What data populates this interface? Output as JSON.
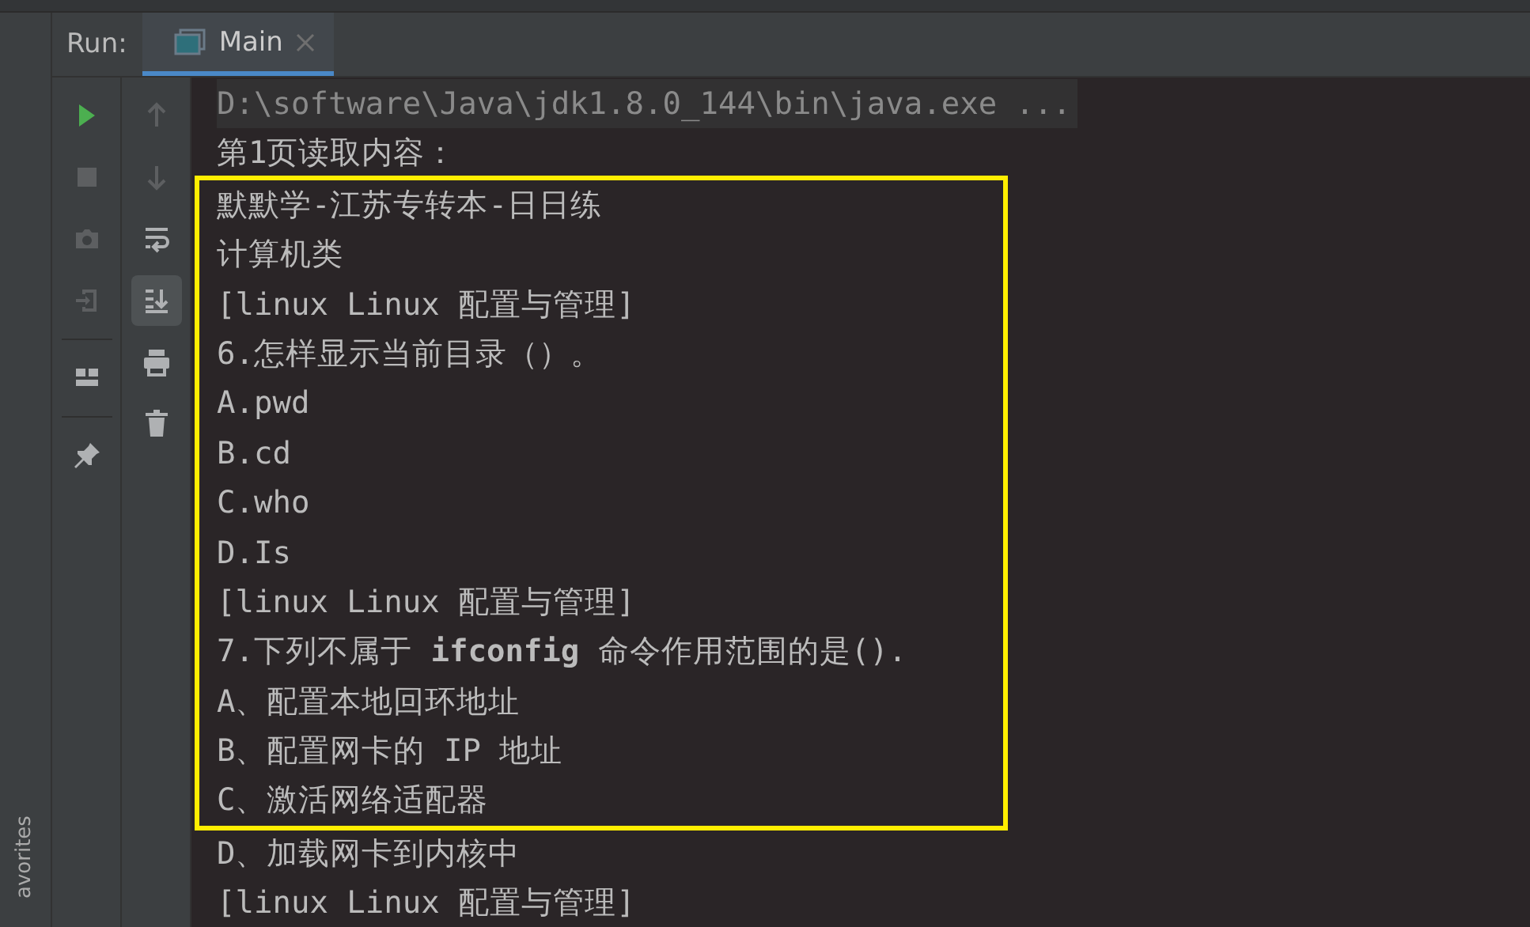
{
  "run_panel": {
    "label": "Run:",
    "tabs": [
      {
        "label": "Main",
        "selected": true
      }
    ]
  },
  "favorites_strip": {
    "label": "avorites"
  },
  "toolbar_left": [
    {
      "kind": "run",
      "disabled": false
    },
    {
      "kind": "stop",
      "disabled": true
    },
    {
      "kind": "camera",
      "disabled": true
    },
    {
      "kind": "enter",
      "disabled": true
    },
    {
      "kind": "separator"
    },
    {
      "kind": "layout",
      "disabled": false
    },
    {
      "kind": "separator"
    },
    {
      "kind": "pin",
      "disabled": false
    }
  ],
  "toolbar_right": [
    {
      "kind": "up",
      "disabled": true,
      "selected": false
    },
    {
      "kind": "down",
      "disabled": true,
      "selected": false
    },
    {
      "kind": "wrap",
      "disabled": false,
      "selected": false
    },
    {
      "kind": "scroll-end",
      "disabled": false,
      "selected": true
    },
    {
      "kind": "print",
      "disabled": false,
      "selected": false
    },
    {
      "kind": "trash",
      "disabled": false,
      "selected": false
    }
  ],
  "console": {
    "lines": [
      {
        "kind": "command",
        "text": "D:\\software\\Java\\jdk1.8.0_144\\bin\\java.exe ...",
        "highlighted": false
      },
      {
        "kind": "output",
        "text": "第1页读取内容：",
        "highlighted": false
      },
      {
        "kind": "output",
        "text": "默默学-江苏专转本-日日练",
        "highlighted": true
      },
      {
        "kind": "output",
        "text": "计算机类",
        "highlighted": true
      },
      {
        "kind": "output",
        "text": "[linux Linux 配置与管理]",
        "highlighted": true
      },
      {
        "kind": "output",
        "text": "6.怎样显示当前目录（）。",
        "highlighted": true
      },
      {
        "kind": "output",
        "text": "A.pwd",
        "highlighted": true
      },
      {
        "kind": "output",
        "text": "B.cd",
        "highlighted": true
      },
      {
        "kind": "output",
        "text": "C.who",
        "highlighted": true
      },
      {
        "kind": "output",
        "text": "D.Is",
        "highlighted": true
      },
      {
        "kind": "output",
        "text": "[linux Linux 配置与管理]",
        "highlighted": true
      },
      {
        "kind": "output",
        "text": "7.下列不属于 **ifconfig** 命令作用范围的是().",
        "highlighted": true
      },
      {
        "kind": "output",
        "text": "A、配置本地回环地址",
        "highlighted": true
      },
      {
        "kind": "output",
        "text": "B、配置网卡的 IP 地址",
        "highlighted": true
      },
      {
        "kind": "output",
        "text": "C、激活网络适配器",
        "highlighted": true
      },
      {
        "kind": "output",
        "text": "D、加载网卡到内核中",
        "highlighted": false
      },
      {
        "kind": "output",
        "text": "[linux Linux 配置与管理]",
        "highlighted": false
      }
    ]
  }
}
